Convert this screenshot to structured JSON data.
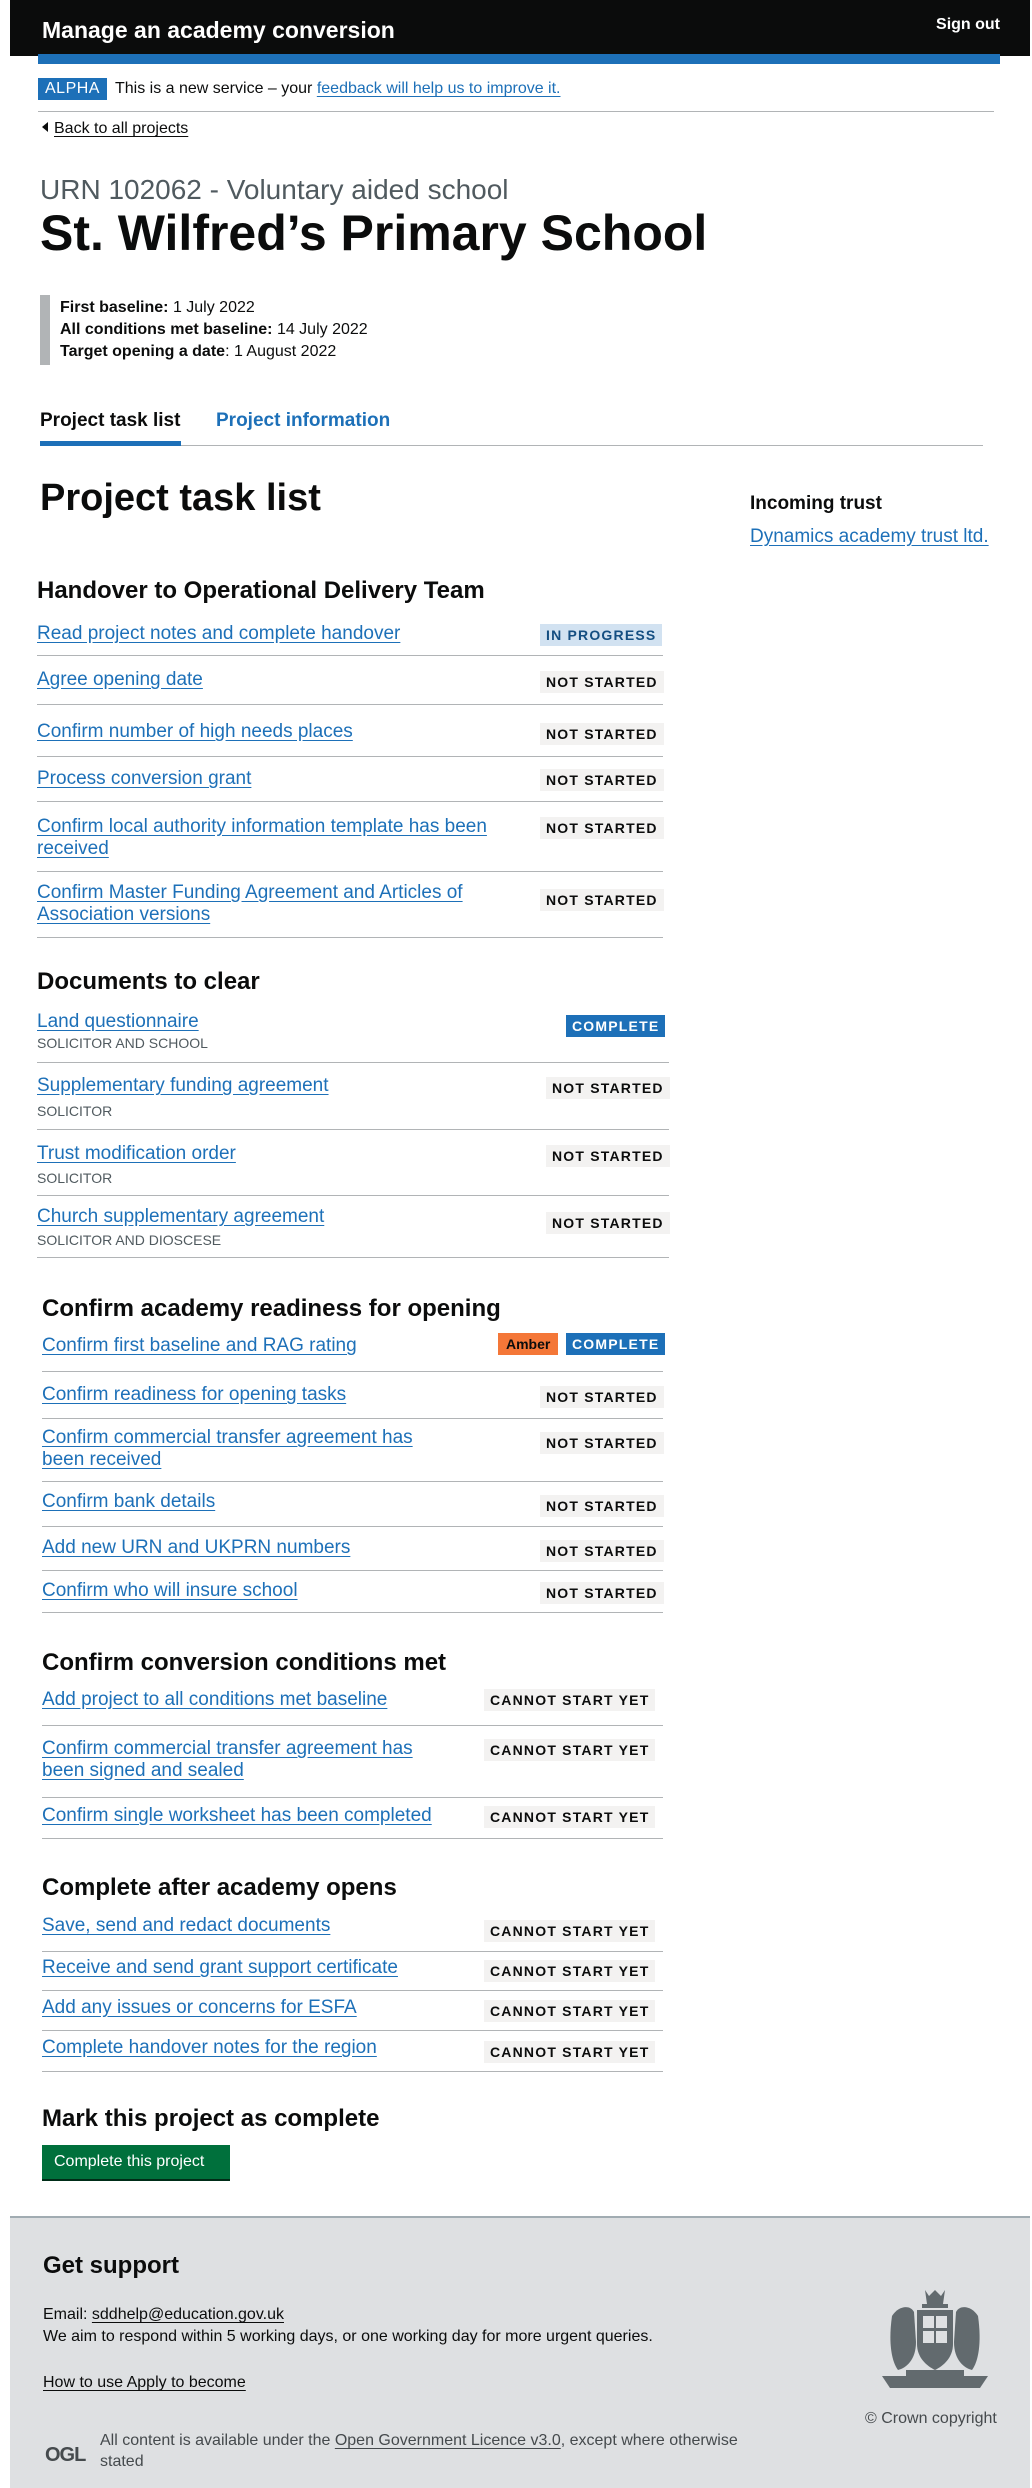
{
  "header": {
    "service_name": "Manage an academy conversion",
    "sign_out": "Sign out"
  },
  "phase_banner": {
    "tag": "ALPHA",
    "text": "This is a new service – your",
    "link": "feedback will help us to improve it."
  },
  "back_link": "Back to all projects",
  "project": {
    "caption": "URN 102062 - Voluntary aided school",
    "title": "St. Wilfred’s Primary School",
    "first_baseline_label": "First baseline:",
    "first_baseline_value": "1 July 2022",
    "conditions_label": "All conditions met baseline:",
    "conditions_value": "14 July 2022",
    "target_label": "Target opening a date",
    "target_value": ": 1 August 2022"
  },
  "tabs": [
    {
      "label": "Project task list",
      "active": true
    },
    {
      "label": "Project information",
      "active": false
    }
  ],
  "page_heading": "Project task list",
  "aside": {
    "title": "Incoming trust",
    "trust_link": "Dynamics academy trust ltd."
  },
  "sections": [
    {
      "title": "Handover to Operational Delivery Team",
      "tasks": [
        {
          "label": "Read project notes and complete handover",
          "status": "IN PROGRESS"
        },
        {
          "label": "Agree opening date",
          "status": "NOT STARTED"
        },
        {
          "label": "Confirm number of high needs places",
          "status": "NOT STARTED"
        },
        {
          "label": "Process conversion grant",
          "status": "NOT STARTED"
        },
        {
          "label": "Confirm local authority information template has been received",
          "status": "NOT STARTED"
        },
        {
          "label": "Confirm Master Funding Agreement and Articles of Association versions",
          "status": "NOT STARTED"
        }
      ]
    },
    {
      "title": "Documents to clear",
      "tasks": [
        {
          "label": "Land questionnaire",
          "hint": "SOLICITOR AND SCHOOL",
          "status": "COMPLETE"
        },
        {
          "label": "Supplementary funding agreement",
          "hint": "SOLICITOR",
          "status": "NOT STARTED"
        },
        {
          "label": "Trust modification order",
          "hint": "SOLICITOR",
          "status": "NOT STARTED"
        },
        {
          "label": "Church supplementary agreement",
          "hint": "SOLICITOR AND DIOSCESE",
          "status": "NOT STARTED"
        }
      ]
    },
    {
      "title": "Confirm academy readiness for opening",
      "tasks": [
        {
          "label": "Confirm first baseline and RAG rating",
          "rag": "Amber",
          "status": "COMPLETE"
        },
        {
          "label": "Confirm readiness for opening tasks",
          "status": "NOT STARTED"
        },
        {
          "label": "Confirm commercial transfer agreement has been received",
          "status": "NOT STARTED"
        },
        {
          "label": "Confirm bank details",
          "status": "NOT STARTED"
        },
        {
          "label": "Add new URN and UKPRN numbers",
          "status": "NOT STARTED"
        },
        {
          "label": "Confirm who will insure school",
          "status": "NOT STARTED"
        }
      ]
    },
    {
      "title": "Confirm conversion conditions met",
      "tasks": [
        {
          "label": "Add project to all conditions met baseline",
          "status": "CANNOT START YET"
        },
        {
          "label": "Confirm commercial transfer agreement has been signed and sealed",
          "status": "CANNOT START YET"
        },
        {
          "label": "Confirm single worksheet has been completed",
          "status": "CANNOT START YET"
        }
      ]
    },
    {
      "title": "Complete after academy opens",
      "tasks": [
        {
          "label": "Save, send and redact documents",
          "status": "CANNOT START YET"
        },
        {
          "label": "Receive and send grant support certificate",
          "status": "CANNOT START YET"
        },
        {
          "label": "Add any issues or concerns for ESFA",
          "status": "CANNOT START YET"
        },
        {
          "label": "Complete handover notes for the region",
          "status": "CANNOT START YET"
        }
      ]
    }
  ],
  "mark_complete": {
    "title": "Mark this project as complete",
    "button": "Complete this project"
  },
  "footer": {
    "support_title": "Get support",
    "email_label": "Email:",
    "email": "sddhelp@education.gov.uk",
    "respond": "We aim to respond within 5 working days, or one working day for more urgent queries.",
    "how_to": "How to use Apply to become",
    "ogl": "OGL",
    "licence_prefix": "All content is available under the",
    "licence_link": "Open Government Licence v3.0",
    "licence_suffix": ", except where otherwise stated",
    "copyright": "© Crown copyright"
  },
  "colors": {
    "header": "#0b0c0c",
    "link": "#1d70b8",
    "complete_tag": "#1d70b8",
    "in_progress_tag": "#d2e2f1",
    "amber_tag": "#f47738",
    "button_green": "#00703c",
    "footer_bg": "#dee0e2"
  }
}
